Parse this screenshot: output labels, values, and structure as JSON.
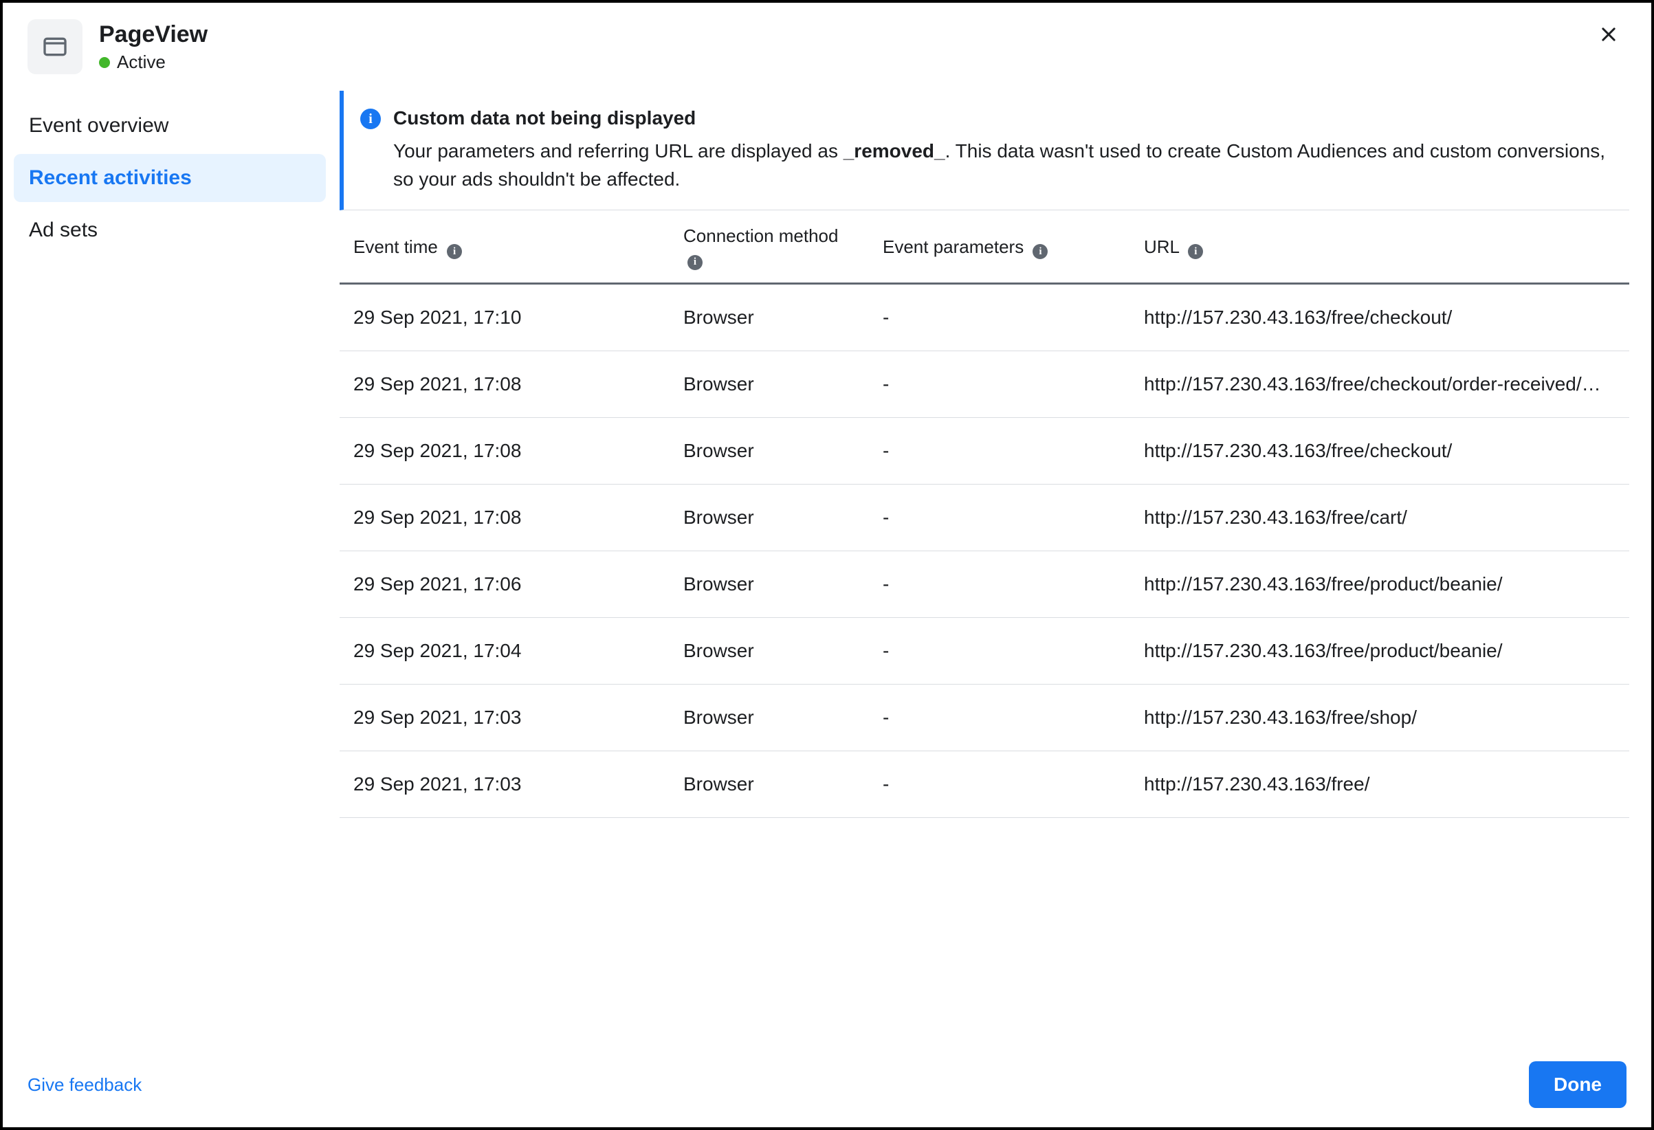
{
  "header": {
    "title": "PageView",
    "status_label": "Active",
    "status_color": "#42b72a"
  },
  "sidebar": {
    "tabs": [
      {
        "label": "Event overview",
        "active": false
      },
      {
        "label": "Recent activities",
        "active": true
      },
      {
        "label": "Ad sets",
        "active": false
      }
    ]
  },
  "alert": {
    "title": "Custom data not being displayed",
    "body_prefix": "Your parameters and referring URL are displayed as ",
    "body_removed": "_removed_",
    "body_suffix": ". This data wasn't used to create Custom Audiences and custom conversions, so your ads shouldn't be affected."
  },
  "table": {
    "columns": [
      {
        "label": "Event time",
        "info": true
      },
      {
        "label": "Connection method",
        "info": true
      },
      {
        "label": "Event parameters",
        "info": true
      },
      {
        "label": "URL",
        "info": true
      }
    ],
    "rows": [
      {
        "time": "29 Sep 2021, 17:10",
        "method": "Browser",
        "params": "-",
        "url": "http://157.230.43.163/free/checkout/"
      },
      {
        "time": "29 Sep 2021, 17:08",
        "method": "Browser",
        "params": "-",
        "url": "http://157.230.43.163/free/checkout/order-received/…"
      },
      {
        "time": "29 Sep 2021, 17:08",
        "method": "Browser",
        "params": "-",
        "url": "http://157.230.43.163/free/checkout/"
      },
      {
        "time": "29 Sep 2021, 17:08",
        "method": "Browser",
        "params": "-",
        "url": "http://157.230.43.163/free/cart/"
      },
      {
        "time": "29 Sep 2021, 17:06",
        "method": "Browser",
        "params": "-",
        "url": "http://157.230.43.163/free/product/beanie/"
      },
      {
        "time": "29 Sep 2021, 17:04",
        "method": "Browser",
        "params": "-",
        "url": "http://157.230.43.163/free/product/beanie/"
      },
      {
        "time": "29 Sep 2021, 17:03",
        "method": "Browser",
        "params": "-",
        "url": "http://157.230.43.163/free/shop/"
      },
      {
        "time": "29 Sep 2021, 17:03",
        "method": "Browser",
        "params": "-",
        "url": "http://157.230.43.163/free/"
      }
    ]
  },
  "footer": {
    "feedback": "Give feedback",
    "done": "Done"
  }
}
